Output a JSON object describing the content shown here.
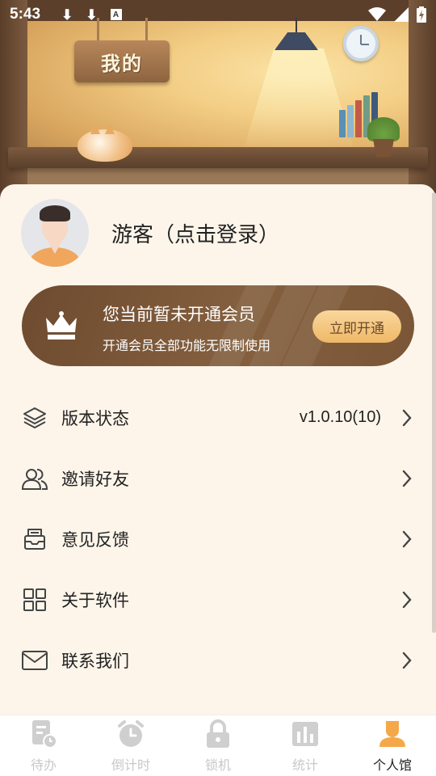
{
  "status_bar": {
    "time": "5:43",
    "download_glyph": "⬇",
    "notification_glyph": "A"
  },
  "header": {
    "sign_text": "我的"
  },
  "profile": {
    "username": "游客（点击登录）"
  },
  "vip": {
    "title": "您当前暂未开通会员",
    "subtitle": "开通会员全部功能无限制使用",
    "button_label": "立即开通"
  },
  "menu": {
    "items": [
      {
        "label": "版本状态",
        "value": "v1.0.10(10)",
        "icon": "layers-icon"
      },
      {
        "label": "邀请好友",
        "value": "",
        "icon": "users-icon"
      },
      {
        "label": "意见反馈",
        "value": "",
        "icon": "feedback-inbox-icon"
      },
      {
        "label": "关于软件",
        "value": "",
        "icon": "grid-apps-icon"
      },
      {
        "label": "联系我们",
        "value": "",
        "icon": "mail-icon"
      }
    ]
  },
  "tabbar": {
    "tabs": [
      {
        "label": "待办",
        "icon": "todo-document-icon",
        "active": false
      },
      {
        "label": "倒计时",
        "icon": "alarm-clock-icon",
        "active": false
      },
      {
        "label": "锁机",
        "icon": "lock-icon",
        "active": false
      },
      {
        "label": "统计",
        "icon": "bar-chart-icon",
        "active": false
      },
      {
        "label": "个人馆",
        "icon": "person-icon",
        "active": true
      }
    ]
  },
  "colors": {
    "background": "#fdf5ea",
    "vip_banner": "#7a5637",
    "vip_button": "#f5c880",
    "tab_active_icon": "#f5a84a",
    "tab_inactive": "#c8c8c8",
    "text_primary": "#222222"
  }
}
